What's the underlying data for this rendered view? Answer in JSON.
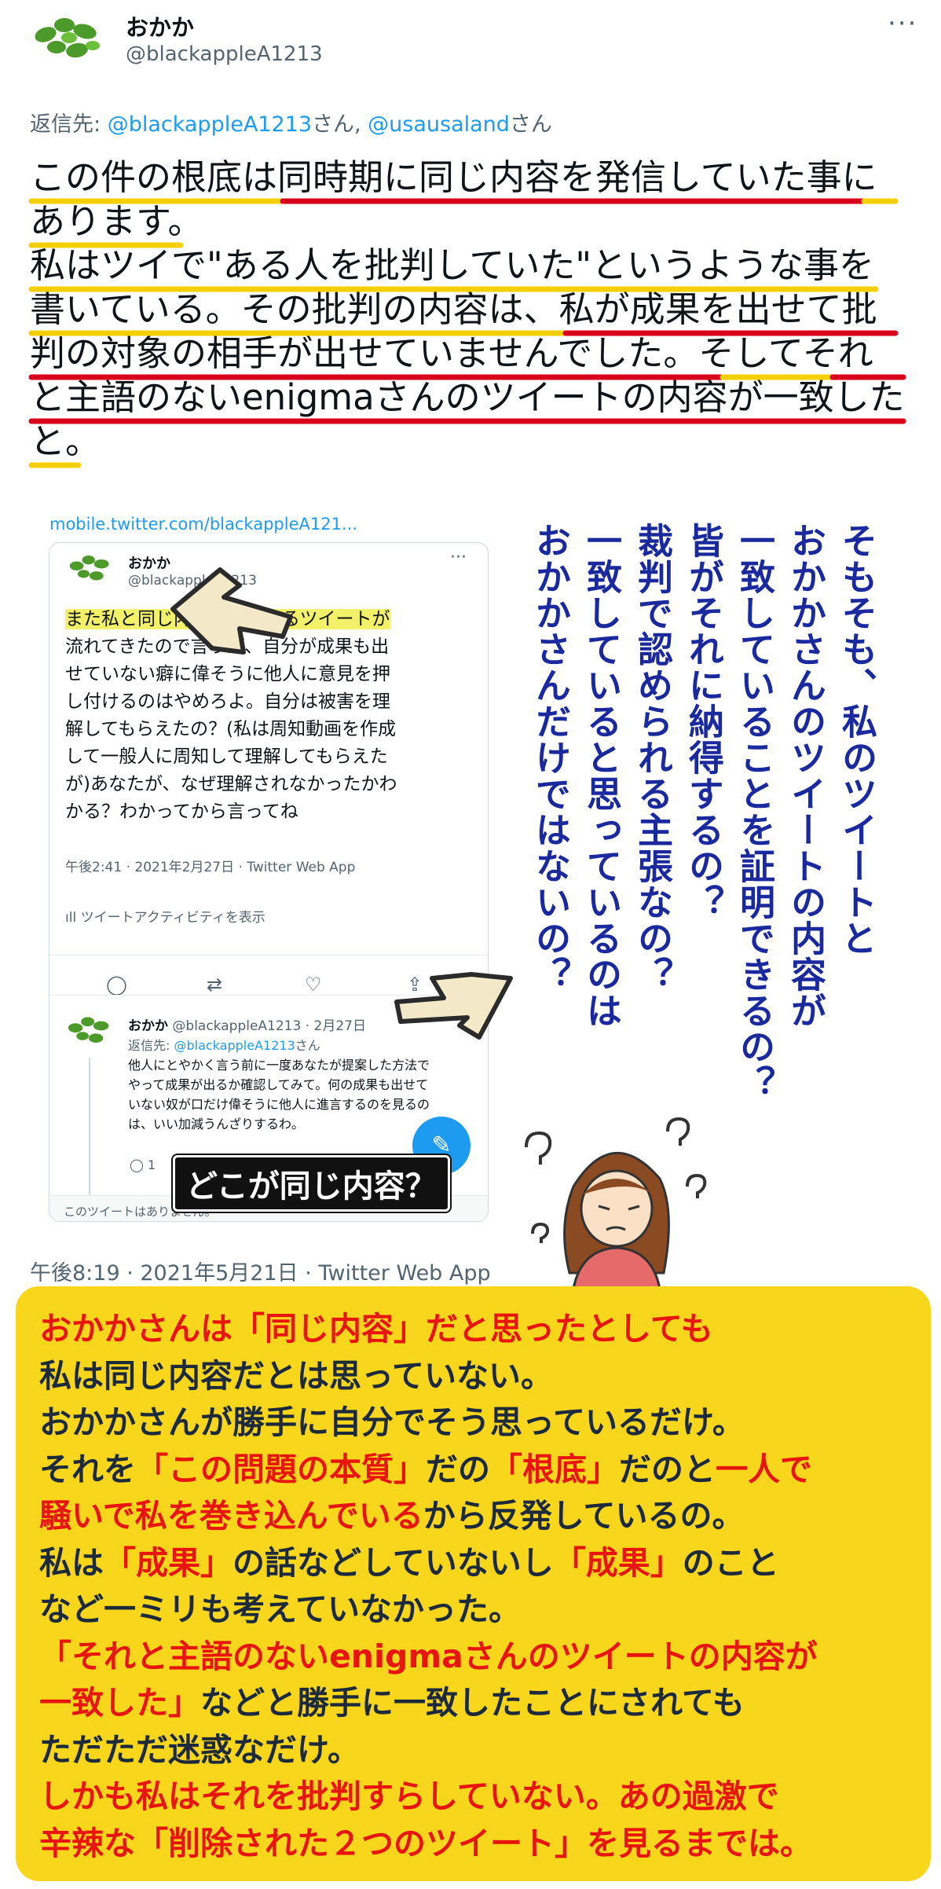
{
  "header": {
    "name": "おかか",
    "handle": "@blackappleA1213",
    "more": "···"
  },
  "reply": {
    "prefix": "返信先: ",
    "mention1": "@blackappleA1213",
    "san1": "さん, ",
    "mention2": "@usausaland",
    "san2": "さん"
  },
  "tweet_lines": [
    "この件の根底は同時期に同じ内容を発信していた事に",
    "あります。",
    "私はツイで\"ある人を批判していた\"というような事を",
    "書いている。その批判の内容は、私が成果を出せて批",
    "判の対象の相手が出せていませんでした。そしてそれ",
    "と主語のないenigmaさんのツイートの内容が一致した",
    "と。"
  ],
  "embed": {
    "link": "mobile.twitter.com/blackappleA121...",
    "name": "おかか",
    "handle": "@blackappleA1213",
    "body_lines": [
      "また私と同じ内容で批判するツイートが",
      "流れてきたので言うが、自分が成果も出",
      "せていない癖に偉そうに他人に意見を押",
      "し付けるのはやめろよ。自分は被害を理",
      "解してもらえたの？(私は周知動画を作成",
      "して一般人に周知して理解してもらえた",
      "が)あなたが、なぜ理解されなかったかわ",
      "かる？わかってから言ってね"
    ],
    "time": "午後2:41 · 2021年2月27日 · Twitter Web App",
    "activity": "ツイートアクティビティを表示",
    "reply_tweet": {
      "name": "おかか",
      "handle": "@blackappleA1213 · 2月27日",
      "reply_prefix": "返信先: ",
      "reply_mention": "@blackappleA1213",
      "reply_suffix": "さん",
      "body_lines": [
        "他人にとやかく言う前に一度あなたが提案した方法で",
        "やって成果が出るか確認してみて。何の成果も出せて",
        "いない奴が口だけ偉そうに他人に進言するのを見るの",
        "は、いい加減うんざりするわ。"
      ],
      "reply_count": "1"
    },
    "deleted": "このツイートはありません。"
  },
  "caption": "どこが同じ内容？",
  "vertical_columns": [
    "そもそも、私のツイートと",
    "おかかさんのツイートの内容が",
    "一致していることを証明できるの？",
    "皆がそれに納得するの？",
    "裁判で認められる主張なの？",
    "一致していると思っているのは",
    "おかかさんだけではないの？"
  ],
  "timestamp": "午後8:19 · 2021年5月21日 · Twitter Web App",
  "note_lines": [
    [
      {
        "t": "おかかさんは「同じ内容」だと思ったとしても",
        "red": true
      }
    ],
    [
      {
        "t": "私は同じ内容だとは思っていない。",
        "red": false
      }
    ],
    [
      {
        "t": "おかかさんが勝手に自分でそう思っているだけ。",
        "red": false
      }
    ],
    [
      {
        "t": "それを",
        "red": false
      },
      {
        "t": "「この問題の本質」",
        "red": true
      },
      {
        "t": "だの",
        "red": false
      },
      {
        "t": "「根底」",
        "red": true
      },
      {
        "t": "だのと",
        "red": false
      },
      {
        "t": "一人で",
        "red": true
      }
    ],
    [
      {
        "t": "騒いで私を巻き込んでいる",
        "red": true
      },
      {
        "t": "から反発しているの。",
        "red": false
      }
    ],
    [
      {
        "t": "私は",
        "red": false
      },
      {
        "t": "「成果」",
        "red": true
      },
      {
        "t": "の話などしていないし",
        "red": false
      },
      {
        "t": "「成果」",
        "red": true
      },
      {
        "t": "のこと",
        "red": false
      }
    ],
    [
      {
        "t": "など一ミリも考えていなかった。",
        "red": false
      }
    ],
    [
      {
        "t": "「それと主語のないenigmaさんのツイートの内容が",
        "red": true
      }
    ],
    [
      {
        "t": "一致した」",
        "red": true
      },
      {
        "t": "などと勝手に一致したことにされても",
        "red": false
      }
    ],
    [
      {
        "t": "ただただ迷惑なだけ。",
        "red": false
      }
    ],
    [
      {
        "t": "しかも私はそれを批判すらしていない。あの過激で",
        "red": true
      }
    ],
    [
      {
        "t": "辛辣な「削除された２つのツイート」を見るまでは。",
        "red": true
      }
    ]
  ],
  "colors": {
    "link": "#1d9bf0",
    "underline_red": "#d9001b",
    "underline_yellow": "#f5d000",
    "vertical_text": "#1a2a9e",
    "note_bg": "#f7d61c",
    "note_red": "#e8140e"
  }
}
